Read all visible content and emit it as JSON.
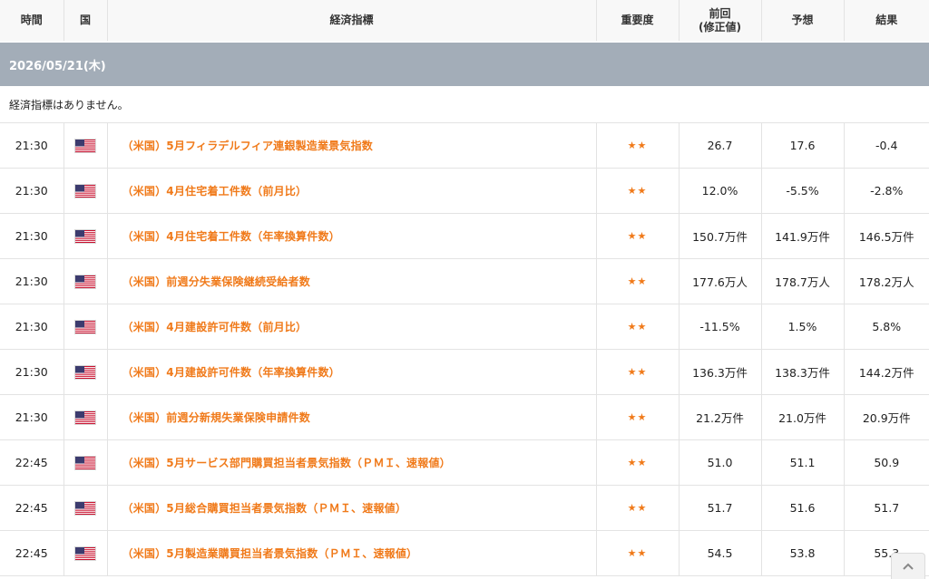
{
  "header": {
    "time": "時間",
    "country": "国",
    "indicator": "経済指標",
    "importance": "重要度",
    "previous": "前回\n(修正値)",
    "forecast": "予想",
    "result": "結果"
  },
  "date_section": {
    "date": "2026/05/21(木)",
    "notice": "経済指標はありません。"
  },
  "flag_icon": "us-flag-icon",
  "colors": {
    "accent": "#f07a1a",
    "date_bar": "#a3adb8",
    "header_bg": "#f8f8f8"
  },
  "events": [
    {
      "time": "21:30",
      "name": "（米国）5月フィラデルフィア連銀製造業景気指数",
      "stars": "★★",
      "previous": "26.7",
      "forecast": "17.6",
      "result": "-0.4"
    },
    {
      "time": "21:30",
      "name": "（米国）4月住宅着工件数（前月比）",
      "stars": "★★",
      "previous": "12.0%",
      "forecast": "-5.5%",
      "result": "-2.8%"
    },
    {
      "time": "21:30",
      "name": "（米国）4月住宅着工件数（年率換算件数）",
      "stars": "★★",
      "previous": "150.7万件",
      "forecast": "141.9万件",
      "result": "146.5万件"
    },
    {
      "time": "21:30",
      "name": "（米国）前週分失業保険継続受給者数",
      "stars": "★★",
      "previous": "177.6万人",
      "forecast": "178.7万人",
      "result": "178.2万人"
    },
    {
      "time": "21:30",
      "name": "（米国）4月建設許可件数（前月比）",
      "stars": "★★",
      "previous": "-11.5%",
      "forecast": "1.5%",
      "result": "5.8%"
    },
    {
      "time": "21:30",
      "name": "（米国）4月建設許可件数（年率換算件数）",
      "stars": "★★",
      "previous": "136.3万件",
      "forecast": "138.3万件",
      "result": "144.2万件"
    },
    {
      "time": "21:30",
      "name": "（米国）前週分新規失業保険申請件数",
      "stars": "★★",
      "previous": "21.2万件",
      "forecast": "21.0万件",
      "result": "20.9万件"
    },
    {
      "time": "22:45",
      "name": "（米国）5月サービス部門購買担当者景気指数（ＰＭＩ、速報値）",
      "stars": "★★",
      "previous": "51.0",
      "forecast": "51.1",
      "result": "50.9"
    },
    {
      "time": "22:45",
      "name": "（米国）5月総合購買担当者景気指数（ＰＭＩ、速報値）",
      "stars": "★★",
      "previous": "51.7",
      "forecast": "51.6",
      "result": "51.7"
    },
    {
      "time": "22:45",
      "name": "（米国）5月製造業購買担当者景気指数（ＰＭＩ、速報値）",
      "stars": "★★",
      "previous": "54.5",
      "forecast": "53.8",
      "result": "55.3"
    }
  ],
  "scroll_top_icon": "chevron-up-icon"
}
